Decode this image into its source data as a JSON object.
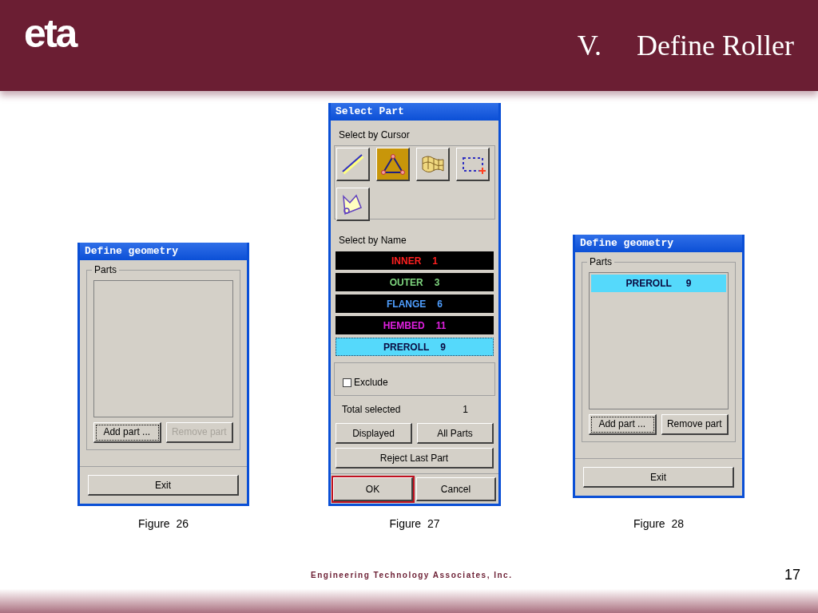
{
  "header": {
    "logo": "eta",
    "title_number": "V.",
    "title": "Define Roller"
  },
  "figures": [
    {
      "caption": "Figure  26",
      "dialog": {
        "kind": "geometry",
        "title": "Define geometry",
        "group_label": "Parts",
        "buttons": [
          {
            "label": "Add part ...",
            "disabled": false,
            "focused": true
          },
          {
            "label": "Remove part",
            "disabled": true,
            "focused": false
          }
        ],
        "exit": "Exit"
      }
    },
    {
      "caption": "Figure  27",
      "dialog": {
        "kind": "select",
        "title": "Select Part",
        "cursor_label": "Select by Cursor",
        "tools": [
          {
            "kind": "line",
            "selected": false
          },
          {
            "kind": "triangle",
            "selected": true
          },
          {
            "kind": "surface",
            "selected": false
          },
          {
            "kind": "box",
            "selected": false
          },
          {
            "kind": "polygon",
            "selected": false
          }
        ],
        "name_label": "Select by Name",
        "parts": [
          {
            "name": "INNER",
            "number": "1",
            "color": "#ff2020",
            "selected": false
          },
          {
            "name": "OUTER",
            "number": "3",
            "color": "#7fd67f",
            "selected": false
          },
          {
            "name": "FLANGE",
            "number": "6",
            "color": "#4f9fff",
            "selected": false
          },
          {
            "name": "HEMBED",
            "number": "11",
            "color": "#e020e0",
            "selected": false
          },
          {
            "name": "PREROLL",
            "number": "9",
            "selected": true
          }
        ],
        "exclude": {
          "label": "Exclude",
          "checked": false
        },
        "total_label": "Total selected",
        "total_value": "1",
        "buttons": [
          {
            "label": "Displayed",
            "focused": false
          },
          {
            "label": "All Parts",
            "focused": false
          },
          {
            "label": "Reject Last Part",
            "focused": false
          }
        ],
        "ok": {
          "label": "OK",
          "focused": true
        },
        "cancel": {
          "label": "Cancel",
          "focused": false
        }
      }
    },
    {
      "caption": "Figure  28",
      "dialog": {
        "kind": "geometry",
        "title": "Define geometry",
        "group_label": "Parts",
        "parts": [
          {
            "name": "PREROLL",
            "number": "9",
            "selected": true
          }
        ],
        "buttons": [
          {
            "label": "Add part ...",
            "disabled": false,
            "focused": true
          },
          {
            "label": "Remove part",
            "disabled": false,
            "focused": false
          }
        ],
        "exit": "Exit"
      }
    }
  ],
  "footer": {
    "company": "Engineering Technology Associates, Inc.",
    "page": "17"
  }
}
